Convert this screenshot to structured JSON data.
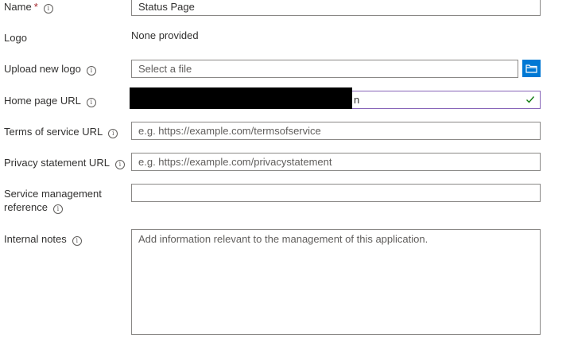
{
  "form": {
    "name": {
      "label": "Name",
      "required_marker": "*",
      "value": "Status Page"
    },
    "logo": {
      "label": "Logo",
      "value": "None provided"
    },
    "upload_logo": {
      "label": "Upload new logo",
      "placeholder": "Select a file",
      "browse_icon": "folder-icon"
    },
    "home_page_url": {
      "label": "Home page URL",
      "value_tail": "n",
      "status_icon": "checkmark-icon",
      "status_color": "#107c10",
      "border_color": "#8764b8"
    },
    "terms_of_service_url": {
      "label": "Terms of service URL",
      "placeholder": "e.g. https://example.com/termsofservice"
    },
    "privacy_statement_url": {
      "label": "Privacy statement URL",
      "placeholder": "e.g. https://example.com/privacystatement"
    },
    "service_management_reference": {
      "label_line1": "Service management",
      "label_line2": "reference",
      "value": ""
    },
    "internal_notes": {
      "label": "Internal notes",
      "placeholder": "Add information relevant to the management of this application."
    }
  },
  "info_glyph": "i",
  "colors": {
    "accent": "#0078d4",
    "required": "#a4262c",
    "border": "#8a8886"
  }
}
